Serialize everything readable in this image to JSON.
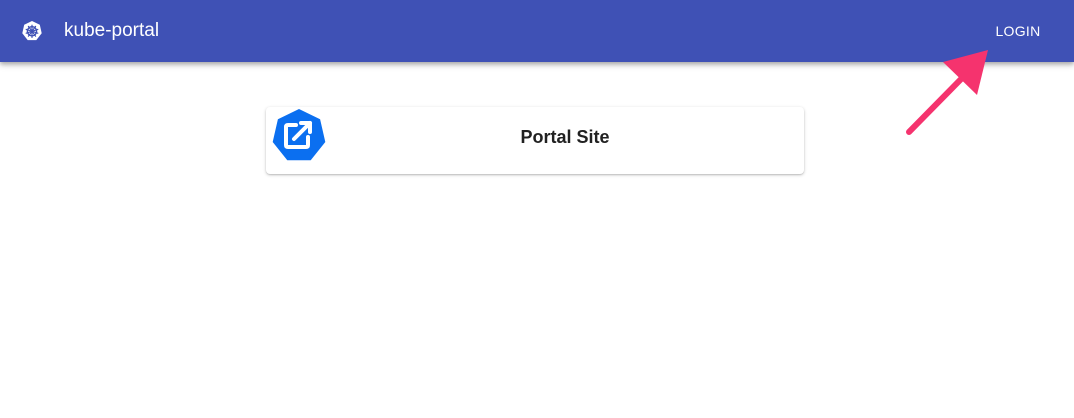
{
  "header": {
    "app_title": "kube-portal",
    "logo_icon": "kubernetes-helm-icon",
    "login_label": "LOGIN",
    "background_color": "#3f51b5"
  },
  "main": {
    "cards": [
      {
        "title": "Portal Site",
        "icon": "external-link-icon",
        "icon_color": "#0b6ff0"
      }
    ]
  },
  "annotation": {
    "arrow_color": "#f5336e"
  }
}
